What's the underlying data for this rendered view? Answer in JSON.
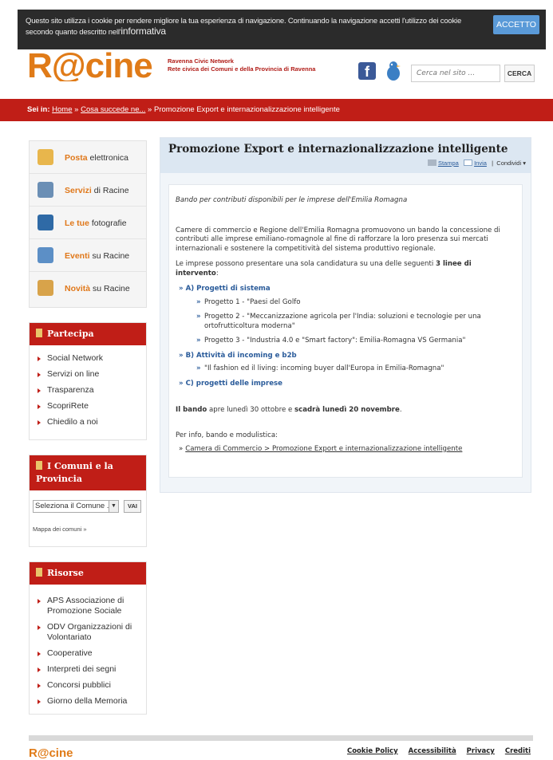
{
  "cookie_bar": {
    "text": "Questo sito utilizza i cookie per rendere migliore la tua esperienza di navigazione. Continuando la navigazione accetti l'utilizzo dei cookie secondo quanto descritto nell'",
    "info_link": "informativa",
    "accept_button": "ACCETTO"
  },
  "header": {
    "logo": "R@cine",
    "tagline_line1": "Ravenna Civic Network",
    "tagline_line2": "Rete civica dei Comuni e della Provincia di Ravenna",
    "facebook_glyph": "f",
    "search_placeholder": "Cerca nel sito ...",
    "search_button": "CERCA"
  },
  "breadcrumb": {
    "label": "Sei in:",
    "home": "Home",
    "sep1": "»",
    "level2": "Cosa succede ne...",
    "sep2": "»",
    "current": "Promozione Export e internazionalizzazione intelligente"
  },
  "left_menu": {
    "items": [
      {
        "highlight": "Posta",
        "rest": "elettronica",
        "icon": "mail-icon",
        "color": "#e8b64c"
      },
      {
        "highlight": "Servizi",
        "rest": "di Racine",
        "icon": "services-icon",
        "color": "#6b8fb5"
      },
      {
        "highlight": "Le tue",
        "rest": "fotografie",
        "icon": "photo-icon",
        "color": "#2f6aa6"
      },
      {
        "highlight": "Eventi",
        "rest": "su Racine",
        "icon": "calendar-icon",
        "color": "#5c8fc6"
      },
      {
        "highlight": "Novità",
        "rest": "su Racine",
        "icon": "news-icon",
        "color": "#d8a34a"
      }
    ]
  },
  "partecipa": {
    "title": "Partecipa",
    "items": [
      "Social Network",
      "Servizi on line",
      "Trasparenza",
      "ScopriRete",
      "Chiedilo a noi"
    ]
  },
  "comuni": {
    "title": "I Comuni e la Provincia",
    "select_value": "Seleziona il Comune ...",
    "go_button": "VAI",
    "map_link": "Mappa dei comuni",
    "map_arrow": "»"
  },
  "risorse": {
    "title": "Risorse",
    "items": [
      "APS Associazione di Promozione Sociale",
      "ODV Organizzazioni di Volontariato",
      "Cooperative",
      "Interpreti dei segni",
      "Concorsi pubblici",
      "Giorno della Memoria"
    ]
  },
  "main": {
    "title": "Promozione Export e internazionalizzazione intelligente",
    "tools": {
      "print": "Stampa",
      "send": "Invia",
      "sep": "|",
      "share": "Condividi ▾"
    },
    "lead": "Bando per contributi disponibili per le imprese dell'Emilia Romagna",
    "para1": "Camere di commercio e Regione dell'Emilia Romagna promuovono un bando la concessione di contributi alle imprese emiliano-romagnole al fine di rafforzare la loro presenza sui mercati internazionali e sostenere la competitività del sistema produttivo regionale.",
    "para2_pre": "Le imprese possono presentare una sola candidatura su una delle seguenti ",
    "para2_bold": "3 linee di intervento",
    "para2_post": ":",
    "sections": [
      {
        "title": "A) Progetti di sistema",
        "items": [
          "Progetto 1 - \"Paesi del Golfo",
          "Progetto 2 - \"Meccanizzazione agricola per l'India: soluzioni e tecnologie per una ortofrutticoltura moderna\"",
          "Progetto 3 - \"Industria 4.0 e \"Smart factory\": Emilia-Romagna VS Germania\""
        ]
      },
      {
        "title": "B) Attività di incoming e b2b",
        "items": [
          "\"Il fashion ed il living: incoming buyer dall'Europa in Emilia-Romagna\""
        ]
      },
      {
        "title": "C) progetti delle imprese",
        "items": []
      }
    ],
    "chevron": "»",
    "deadline_b1": "Il bando",
    "deadline_t1": " apre lunedì 30 ottobre e ",
    "deadline_b2": "scadrà lunedì 20 novembre",
    "deadline_t2": ".",
    "info_label": "Per info, bando e modulistica:",
    "info_link": "Camera di Commercio > Promozione Export e internazionalizzazione intelligente"
  },
  "footer": {
    "logo": "R@cine",
    "links": [
      "Cookie Policy",
      "Accessibilità",
      "Privacy",
      "Crediti"
    ]
  }
}
